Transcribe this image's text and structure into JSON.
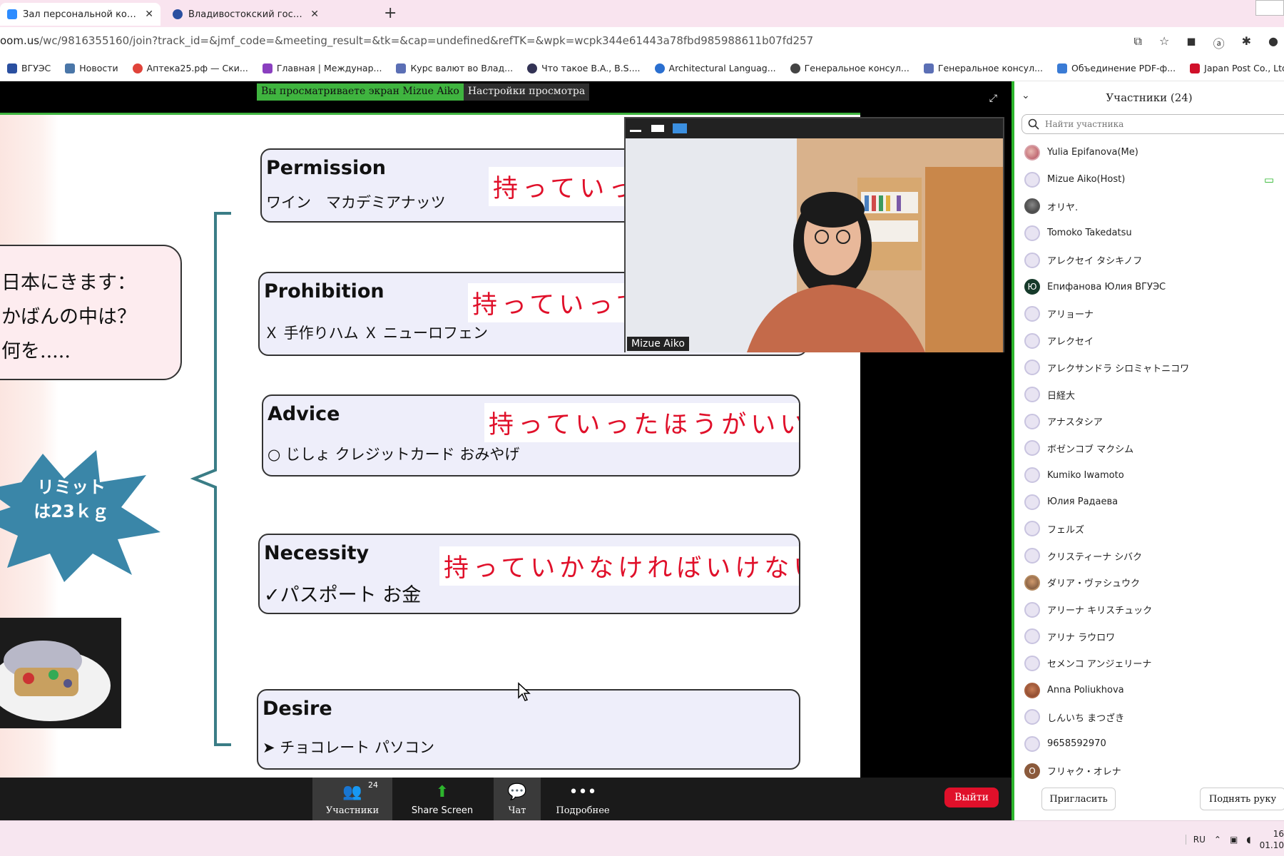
{
  "browser": {
    "tabs": [
      {
        "title": "Зал персональной конференции M",
        "active": true
      },
      {
        "title": "Владивостокский государственный",
        "active": false
      }
    ],
    "url_prefix": "oom.us",
    "url_rest": "/wc/9816355160/join?track_id=&jmf_code=&meeting_result=&tk=&cap=undefined&refTK=&wpk=wcpk344e61443a78fbd985988611b07fd257",
    "bookmarks": [
      "ВГУЭС",
      "Новости",
      "Аптека25.рф — Ски...",
      "Главная | Междунар...",
      "Курс валют во Влад...",
      "Что такое B.A., B.S....",
      "Architectural Languag...",
      "Генеральное консул...",
      "Генеральное консул...",
      "Объединение PDF-ф...",
      "Japan Post Co., Ltd."
    ]
  },
  "zoom": {
    "share_banner": "Вы просматриваете экран Mizue Aiko",
    "view_options": "Настройки просмотра",
    "video_name": "Mizue Aiko",
    "slide": {
      "bubble_lines": [
        "日本にきます：",
        "かばんの中は？",
        "何を....."
      ],
      "burst_lines": [
        "リミット",
        "は23ｋｇ"
      ],
      "cards": [
        {
          "title": "Permission",
          "items": "ワイン　マカデミアナッツ",
          "jp": "持っていってもいい"
        },
        {
          "title": "Prohibition",
          "items": "Ｘ 手作りハム Ｘ ニューロフェン",
          "jp": "持っていってはいけない"
        },
        {
          "title": "Advice",
          "items": "○ じしょ クレジットカード おみやげ",
          "jp": "持っていったほうがいい"
        },
        {
          "title": "Necessity",
          "items": "✓パスポート お金",
          "jp": "持っていかなければいけない"
        },
        {
          "title": "Desire",
          "items": "➤ チョコレート パソコン",
          "jp": ""
        }
      ]
    },
    "toolbar": {
      "participants_label": "Участники",
      "participants_count": "24",
      "share_label": "Share Screen",
      "chat_label": "Чат",
      "more_label": "Подробнее",
      "leave_label": "Выйти"
    }
  },
  "participants": {
    "header": "Участники (24)",
    "search_placeholder": "Найти участника",
    "list": [
      {
        "name": "Yulia Epifanova(Me)",
        "avatar": "photo1",
        "initial": ""
      },
      {
        "name": "Mizue Aiko(Host)",
        "avatar": "default",
        "initial": ""
      },
      {
        "name": "オリヤ.",
        "avatar": "photo4",
        "initial": ""
      },
      {
        "name": "Tomoko Takedatsu",
        "avatar": "default",
        "initial": ""
      },
      {
        "name": "アレクセイ タシキノフ",
        "avatar": "default",
        "initial": ""
      },
      {
        "name": "Епифанова Юлия ВГУЭС",
        "avatar": "dark",
        "initial": "Ю"
      },
      {
        "name": "アリョーナ",
        "avatar": "default",
        "initial": ""
      },
      {
        "name": "アレクセイ",
        "avatar": "default",
        "initial": ""
      },
      {
        "name": "アレクサンドラ シロミャトニコワ",
        "avatar": "default",
        "initial": ""
      },
      {
        "name": "日経大",
        "avatar": "default",
        "initial": ""
      },
      {
        "name": "アナスタシア",
        "avatar": "default",
        "initial": ""
      },
      {
        "name": "ボゼンコブ マクシム",
        "avatar": "default",
        "initial": ""
      },
      {
        "name": "Kumiko Iwamoto",
        "avatar": "default",
        "initial": ""
      },
      {
        "name": "Юлия Радаева",
        "avatar": "default",
        "initial": ""
      },
      {
        "name": "フェルズ",
        "avatar": "default",
        "initial": ""
      },
      {
        "name": "クリスティーナ シバク",
        "avatar": "default",
        "initial": ""
      },
      {
        "name": "ダリア・ヴァシュウク",
        "avatar": "photo2",
        "initial": ""
      },
      {
        "name": "アリーナ キリスチュック",
        "avatar": "default",
        "initial": ""
      },
      {
        "name": "アリナ ラウロワ",
        "avatar": "default",
        "initial": ""
      },
      {
        "name": "セメンコ アンジェリーナ",
        "avatar": "default",
        "initial": ""
      },
      {
        "name": "Anna Poliukhova",
        "avatar": "photo3",
        "initial": ""
      },
      {
        "name": "しんいち まつざき",
        "avatar": "default",
        "initial": ""
      },
      {
        "name": "9658592970",
        "avatar": "default",
        "initial": ""
      },
      {
        "name": "フリャク・オレナ",
        "avatar": "brown",
        "initial": "О"
      }
    ],
    "invite_label": "Пригласить",
    "raise_hand_label": "Поднять руку"
  },
  "taskbar": {
    "lang": "RU",
    "time": "16",
    "date": "01.10"
  }
}
